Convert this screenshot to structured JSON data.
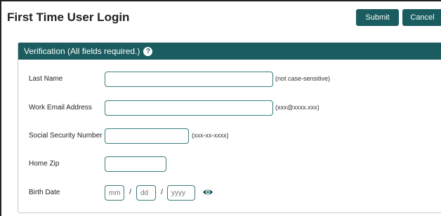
{
  "header": {
    "title": "First Time User Login",
    "submit_label": "Submit",
    "cancel_label": "Cancel"
  },
  "panel": {
    "title": "Verification (All fields required.)",
    "help_icon": "question-circle-icon"
  },
  "fields": {
    "last_name": {
      "label": "Last Name",
      "value": "",
      "hint": "(not case-sensitive)"
    },
    "work_email": {
      "label": "Work Email Address",
      "value": "",
      "hint": "(xxx@xxxx.xxx)"
    },
    "ssn": {
      "label": "Social Security Number",
      "value": "",
      "hint": "(xxx-xx-xxxx)"
    },
    "home_zip": {
      "label": "Home Zip",
      "value": ""
    },
    "birth_date": {
      "label": "Birth Date",
      "mm_placeholder": "mm",
      "dd_placeholder": "dd",
      "yyyy_placeholder": "yyyy",
      "separator": "/",
      "eye_icon": "eye-icon"
    }
  },
  "colors": {
    "accent": "#1a5c5f",
    "field_border": "#3d7c7d"
  }
}
